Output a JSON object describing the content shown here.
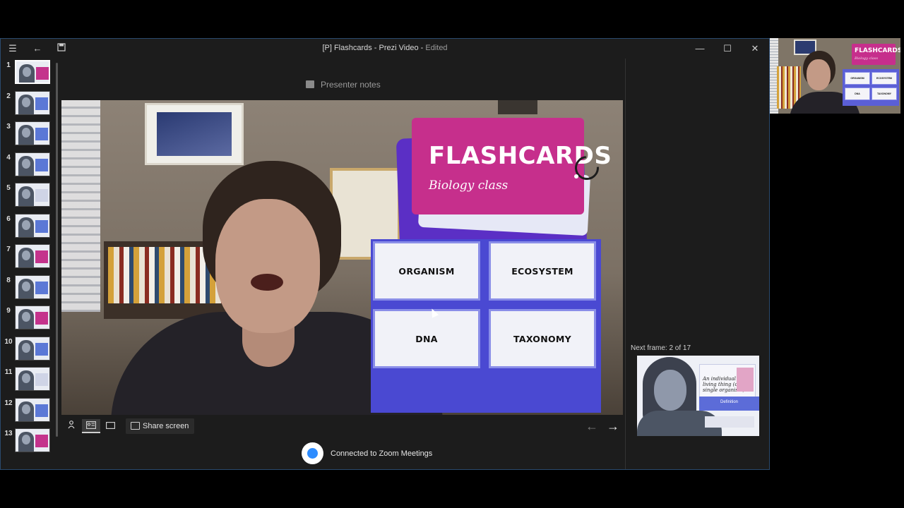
{
  "window": {
    "title": "[P] Flashcards - Prezi Video",
    "status_suffix": "Edited",
    "controls": {
      "minimize": "—",
      "maximize": "☐",
      "close": "✕"
    },
    "menu_icon": "hamburger-menu-icon",
    "back_icon": "back-arrow-icon",
    "save_icon": "save-icon"
  },
  "sidebar": {
    "thumbnails": [
      {
        "number": "1",
        "accent": "pink",
        "active": true
      },
      {
        "number": "2",
        "accent": "blue"
      },
      {
        "number": "3",
        "accent": "blue"
      },
      {
        "number": "4",
        "accent": "blue"
      },
      {
        "number": "5",
        "accent": "light"
      },
      {
        "number": "6",
        "accent": "blue"
      },
      {
        "number": "7",
        "accent": "pink"
      },
      {
        "number": "8",
        "accent": "blue"
      },
      {
        "number": "9",
        "accent": "pink"
      },
      {
        "number": "10",
        "accent": "blue"
      },
      {
        "number": "11",
        "accent": "light"
      },
      {
        "number": "12",
        "accent": "blue"
      },
      {
        "number": "13",
        "accent": "pink"
      }
    ]
  },
  "presenter_notes": {
    "label": "Presenter notes"
  },
  "slide": {
    "title": "FLASHCARDS",
    "subtitle": "Biology class",
    "cards": [
      "ORGANISM",
      "ECOSYSTEM",
      "DNA",
      "TAXONOMY"
    ],
    "colors": {
      "title_card": "#c62f8c",
      "card_grid": "#4a49d2",
      "card_border": "#8a8ee8"
    }
  },
  "toolbar": {
    "share_screen": "Share screen",
    "prev_arrow": "←",
    "next_arrow": "→"
  },
  "status": {
    "text": "Connected to Zoom Meetings",
    "zoom_color": "#2d8cff"
  },
  "next_frame": {
    "label": "Next frame: 2 of 17",
    "preview_text": "An individual living thing (one single organism)",
    "preview_band": "Definition"
  },
  "camera_tile": {
    "title": "FLASHCARDS",
    "subtitle": "Biology class",
    "cards": [
      "ORGANISM",
      "ECOSYSTEM",
      "DNA",
      "TAXONOMY"
    ]
  }
}
